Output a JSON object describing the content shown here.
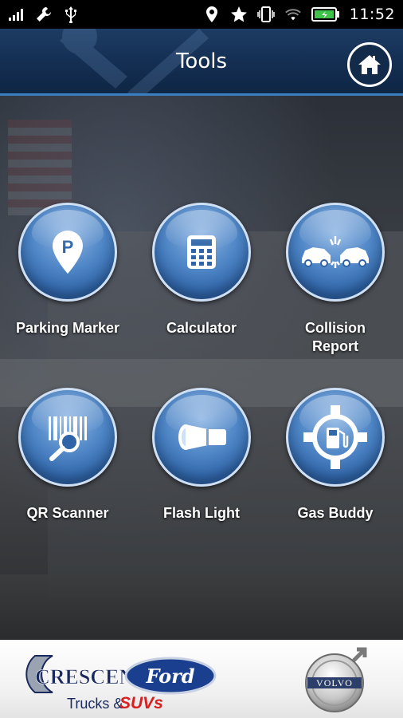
{
  "status_bar": {
    "time": "11:52",
    "icons": [
      "signal-icon",
      "wrench-icon",
      "usb-icon",
      "location-icon",
      "star-icon",
      "vibrate-icon",
      "wifi-icon",
      "battery-icon"
    ]
  },
  "header": {
    "title": "Tools",
    "home_icon": "home-icon"
  },
  "tools": [
    {
      "label": "Parking Marker",
      "icon": "parking-pin-icon"
    },
    {
      "label": "Calculator",
      "icon": "calculator-icon"
    },
    {
      "label": "Collision Report",
      "label_lines": [
        "Collision",
        "Report"
      ],
      "icon": "collision-icon"
    },
    {
      "label": "QR Scanner",
      "icon": "qr-scanner-icon"
    },
    {
      "label": "Flash Light",
      "icon": "flashlight-icon"
    },
    {
      "label": "Gas Buddy",
      "icon": "gas-pump-icon"
    }
  ],
  "footer": {
    "dealer_logo": {
      "brand": "CRESCENT",
      "make": "Ford",
      "tagline_prefix": "Trucks &",
      "tagline_suffix": "SUVs"
    },
    "volvo_logo": {
      "text": "VOLVO"
    }
  },
  "colors": {
    "header_bg": "#153055",
    "header_border": "#3a7fc1",
    "tool_circle": "#4f86c6",
    "tool_ring": "#cfe0f5",
    "label_text": "#ffffff",
    "suvs_red": "#d81e1e",
    "crescent_navy": "#1b2a5e"
  }
}
